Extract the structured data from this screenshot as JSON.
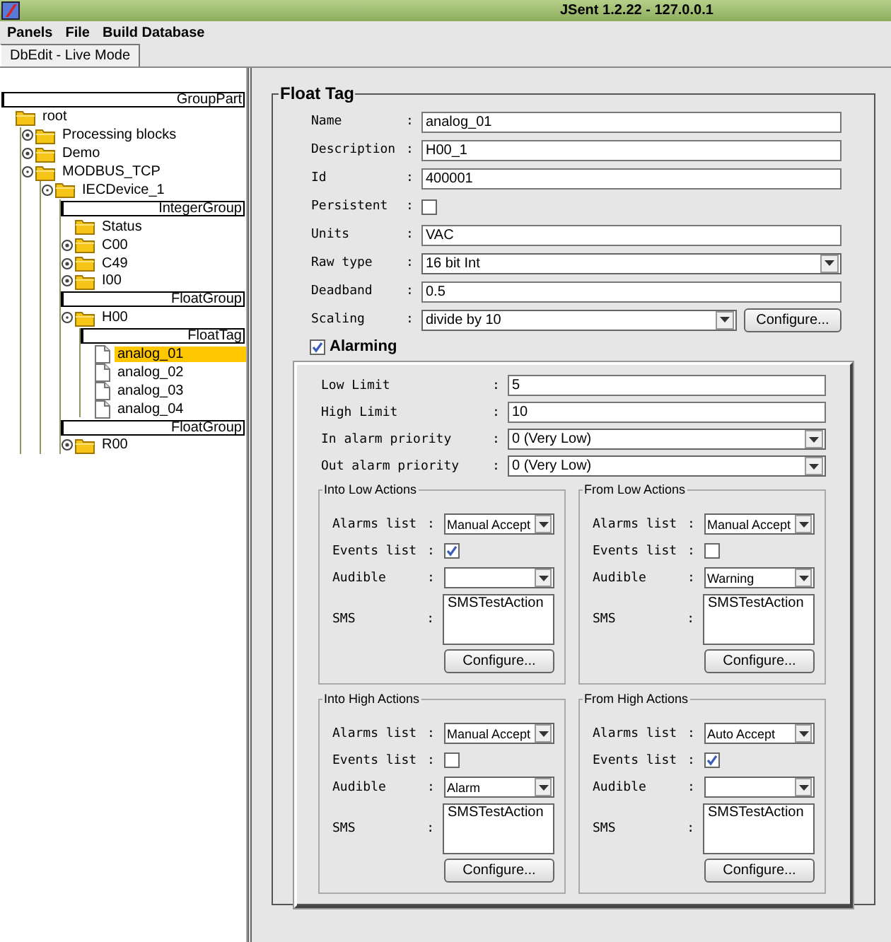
{
  "window": {
    "title": "JSent 1.2.22 - 127.0.0.1"
  },
  "menu": [
    "Panels",
    "File",
    "Build Database"
  ],
  "tabs": [
    {
      "label": "DbEdit - Live Mode",
      "selected": true
    }
  ],
  "tree": [
    {
      "kind": "header",
      "label": "GroupPart"
    },
    {
      "kind": "folder",
      "label": "root",
      "children": [
        {
          "kind": "folder",
          "label": "Processing blocks",
          "expanded": false
        },
        {
          "kind": "folder",
          "label": "Demo",
          "expanded": false
        },
        {
          "kind": "folder",
          "label": "MODBUS_TCP",
          "expanded": true,
          "children": [
            {
              "kind": "folder",
              "label": "IECDevice_1",
              "expanded": true,
              "children": [
                {
                  "kind": "header",
                  "label": "IntegerGroup"
                },
                {
                  "kind": "empty-folder",
                  "label": "Status"
                },
                {
                  "kind": "folder",
                  "label": "C00",
                  "expanded": false
                },
                {
                  "kind": "folder",
                  "label": "C49",
                  "expanded": false
                },
                {
                  "kind": "folder",
                  "label": "I00",
                  "expanded": false
                },
                {
                  "kind": "header",
                  "label": "FloatGroup"
                },
                {
                  "kind": "folder",
                  "label": "H00",
                  "expanded": true,
                  "children": [
                    {
                      "kind": "header",
                      "label": "FloatTag"
                    },
                    {
                      "kind": "leaf",
                      "label": "analog_01",
                      "selected": true
                    },
                    {
                      "kind": "leaf",
                      "label": "analog_02",
                      "selected": false
                    },
                    {
                      "kind": "leaf",
                      "label": "analog_03",
                      "selected": false
                    },
                    {
                      "kind": "leaf",
                      "label": "analog_04",
                      "selected": false
                    }
                  ]
                },
                {
                  "kind": "header",
                  "label": "FloatGroup"
                },
                {
                  "kind": "folder",
                  "label": "R00",
                  "expanded": false
                }
              ]
            }
          ]
        }
      ]
    }
  ],
  "editor": {
    "title": "Float Tag",
    "fields": [
      {
        "kind": "text",
        "label": "Name",
        "separator": ":",
        "value": "analog_01"
      },
      {
        "kind": "text",
        "label": "Description",
        "separator": ":",
        "value": "H00_1"
      },
      {
        "kind": "text",
        "label": "Id",
        "separator": ":",
        "value": "400001"
      },
      {
        "kind": "checkbox",
        "label": "Persistent",
        "separator": ":",
        "checked": false
      },
      {
        "kind": "text",
        "label": "Units",
        "separator": ":",
        "value": "VAC"
      },
      {
        "kind": "select",
        "label": "Raw type",
        "separator": ":",
        "value": "16 bit Int"
      },
      {
        "kind": "text",
        "label": "Deadband",
        "separator": ":",
        "value": "0.5"
      },
      {
        "kind": "select-button",
        "label": "Scaling",
        "separator": ":",
        "value": "divide by 10",
        "button": "Configure..."
      }
    ],
    "alarming": {
      "label": "Alarming",
      "checked": true
    },
    "alarm_fields": [
      {
        "kind": "text",
        "label": "Low Limit",
        "separator": ":",
        "value": "5"
      },
      {
        "kind": "text",
        "label": "High Limit",
        "separator": ":",
        "value": "10"
      },
      {
        "kind": "select",
        "label": "In alarm priority",
        "separator": ":",
        "value": "0 (Very Low)"
      },
      {
        "kind": "select",
        "label": "Out alarm priority",
        "separator": ":",
        "value": "0 (Very Low)"
      }
    ],
    "action_groups": [
      {
        "title": "Into Low Actions",
        "fields": [
          {
            "kind": "select",
            "label": "Alarms list",
            "separator": ":",
            "value": "Manual Accept"
          },
          {
            "kind": "checkbox",
            "label": "Events list",
            "separator": ":",
            "checked": true
          },
          {
            "kind": "select",
            "label": "Audible",
            "separator": ":"
          },
          {
            "kind": "textarea",
            "label": "SMS",
            "separator": ":",
            "value": "SMSTestAction"
          }
        ],
        "button": "Configure..."
      },
      {
        "title": "From Low Actions",
        "fields": [
          {
            "kind": "select",
            "label": "Alarms list",
            "separator": ":",
            "value": "Manual Accept"
          },
          {
            "kind": "checkbox",
            "label": "Events list",
            "separator": ":",
            "checked": false
          },
          {
            "kind": "select",
            "label": "Audible",
            "separator": ":",
            "value": "Warning"
          },
          {
            "kind": "textarea",
            "label": "SMS",
            "separator": ":",
            "value": "SMSTestAction"
          }
        ],
        "button": "Configure..."
      },
      {
        "title": "Into High Actions",
        "fields": [
          {
            "kind": "select",
            "label": "Alarms list",
            "separator": ":",
            "value": "Manual Accept"
          },
          {
            "kind": "checkbox",
            "label": "Events list",
            "separator": ":",
            "checked": false
          },
          {
            "kind": "select",
            "label": "Audible",
            "separator": ":",
            "value": "Alarm"
          },
          {
            "kind": "textarea",
            "label": "SMS",
            "separator": ":",
            "value": "SMSTestAction"
          }
        ],
        "button": "Configure..."
      },
      {
        "title": "From High Actions",
        "fields": [
          {
            "kind": "select",
            "label": "Alarms list",
            "separator": ":",
            "value": "Auto Accept"
          },
          {
            "kind": "checkbox",
            "label": "Events list",
            "separator": ":",
            "checked": true
          },
          {
            "kind": "select",
            "label": "Audible",
            "separator": ":"
          },
          {
            "kind": "textarea",
            "label": "SMS",
            "separator": ":",
            "value": "SMSTestAction"
          }
        ],
        "button": "Configure..."
      }
    ]
  }
}
